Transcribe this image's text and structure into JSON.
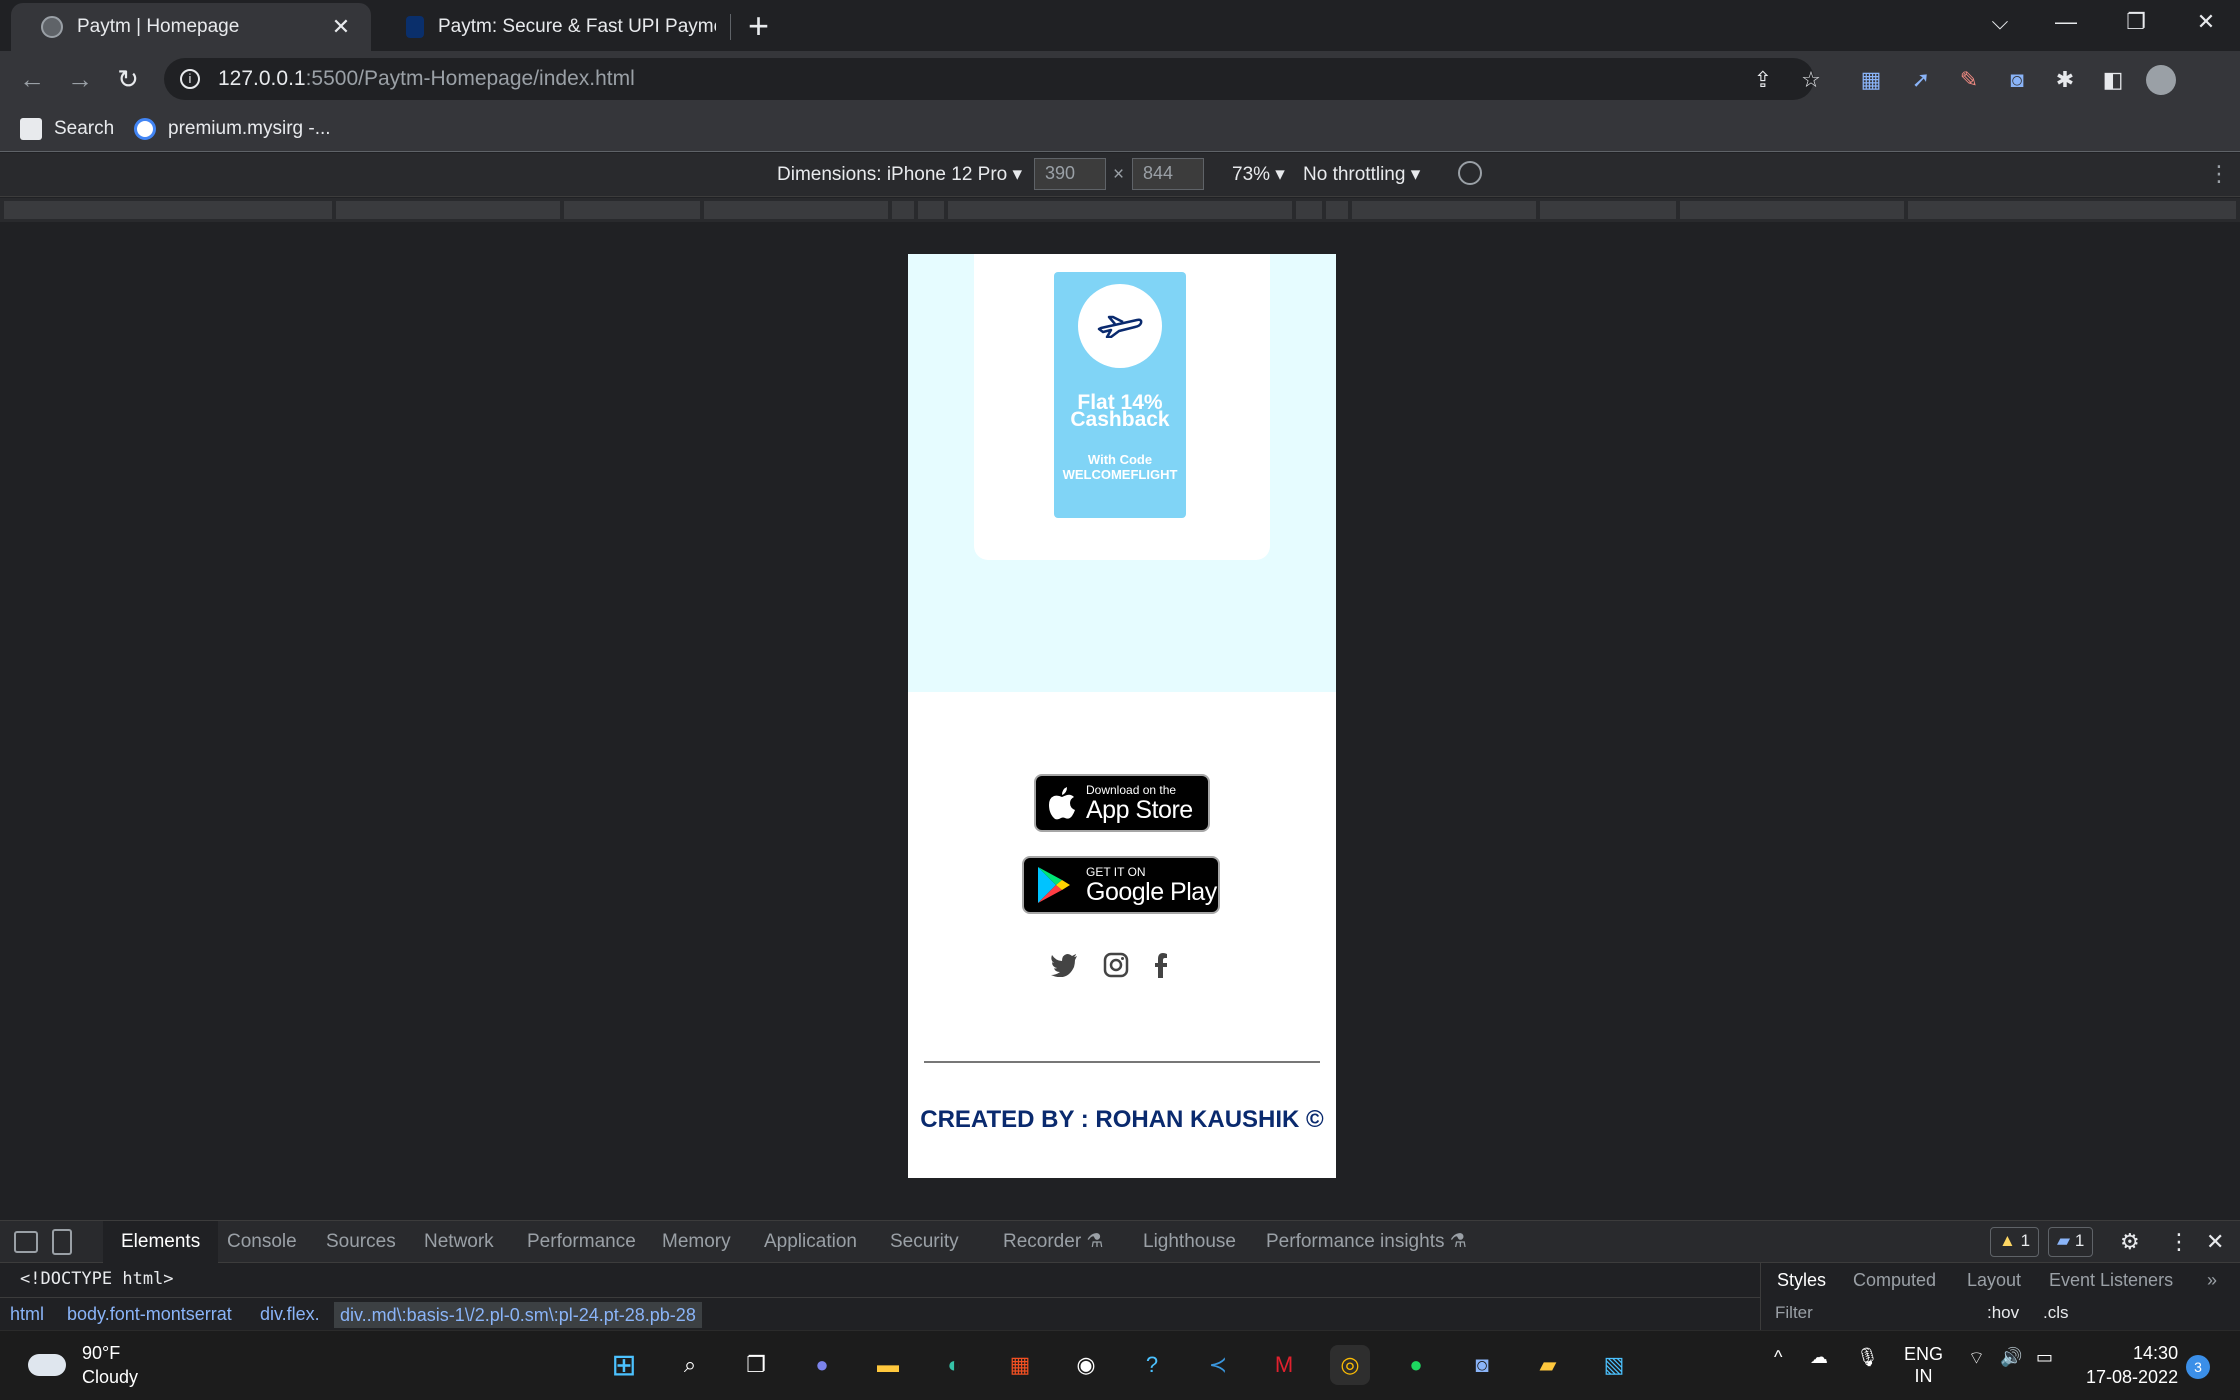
{
  "browser": {
    "tabs": [
      {
        "title": "Paytm | Homepage",
        "active": true
      },
      {
        "title": "Paytm: Secure & Fast UPI Paymen",
        "active": false
      }
    ],
    "url_host": "127.0.0.1",
    "url_path": ":5500/Paytm-Homepage/index.html",
    "bookmarks": [
      {
        "label": "Search"
      },
      {
        "label": "premium.mysirg -..."
      }
    ]
  },
  "device_toolbar": {
    "dimensions_label": "Dimensions: iPhone 12 Pro",
    "width": "390",
    "height": "844",
    "times": "×",
    "zoom": "73%",
    "throttling": "No throttling"
  },
  "page": {
    "offer": {
      "headline_line1": "Flat 14%",
      "headline_line2": "Cashback",
      "code_label": "With Code",
      "code": "WELCOMEFLIGHT"
    },
    "app_store": {
      "small": "Download on the",
      "big": "App Store"
    },
    "google_play": {
      "small": "GET IT ON",
      "big": "Google Play"
    },
    "credit": "CREATED BY : ROHAN KAUSHIK ©",
    "colors": {
      "sky": "#e6fcff",
      "offer": "#80d4f6",
      "credit": "#0a2a6e"
    }
  },
  "devtools": {
    "tabs": [
      "Elements",
      "Console",
      "Sources",
      "Network",
      "Performance",
      "Memory",
      "Application",
      "Security",
      "Recorder",
      "Lighthouse",
      "Performance insights"
    ],
    "warnings": "1",
    "messages": "1",
    "doctype": "<!DOCTYPE html>",
    "breadcrumbs": [
      "html",
      "body.font-montserrat",
      "div.flex.",
      "div..md\\:basis-1\\/2.pl-0.sm\\:pl-24.pt-28.pb-28"
    ],
    "styles_tabs": [
      "Styles",
      "Computed",
      "Layout",
      "Event Listeners"
    ],
    "filter_placeholder": "Filter",
    "hov": ":hov",
    "cls": ".cls"
  },
  "taskbar": {
    "temp": "90°F",
    "condition": "Cloudy",
    "lang1": "ENG",
    "lang2": "IN",
    "time": "14:30",
    "date": "17-08-2022",
    "notifications": "3"
  }
}
